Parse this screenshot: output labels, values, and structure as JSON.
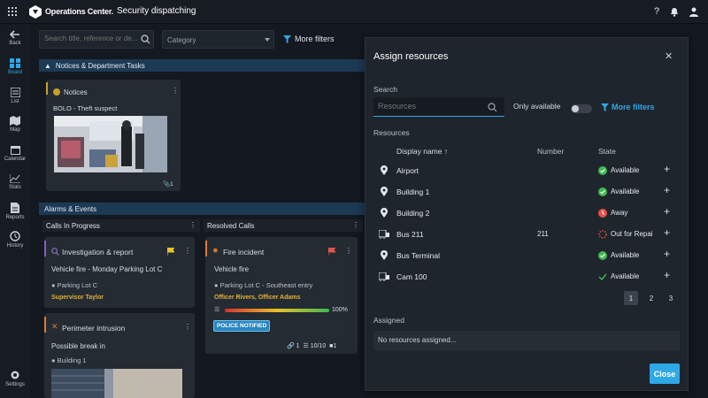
{
  "topbar": {
    "app_name": "Operations Center.",
    "page_title": "Security dispatching"
  },
  "sidebar": {
    "items": [
      {
        "label": "Back"
      },
      {
        "label": "Board"
      },
      {
        "label": "List"
      },
      {
        "label": "Map"
      },
      {
        "label": "Calendar"
      },
      {
        "label": "Stats"
      },
      {
        "label": "Reports"
      },
      {
        "label": "History"
      },
      {
        "label": "Settings"
      }
    ]
  },
  "filters": {
    "search_placeholder": "Search title, reference or de...",
    "category": "Category",
    "more_filters": "More filters"
  },
  "notices": {
    "section_title": "Notices & Department Tasks",
    "card_title": "Notices",
    "item_title": "BOLO - Theft suspect",
    "attachments": "1"
  },
  "alarms": {
    "section_title": "Alarms & Events",
    "col1": "Calls In Progress",
    "col2": "Resolved Calls",
    "c1": {
      "title": "Investigation & report",
      "subtitle": "Vehicle fire - Monday Parking Lot C",
      "location": "Parking Lot C",
      "assignee": "Supervisor Taylor"
    },
    "c2": {
      "title": "Perimeter intrusion",
      "subtitle": "Possible break in",
      "location": "Building 1"
    },
    "c3": {
      "title": "Fire incident",
      "subtitle": "Vehicle fire",
      "location": "Parking Lot C - Southeast entry",
      "assignee": "Officer Rivers, Officer Adams",
      "progress": "100%",
      "badge": "POLICE NOTIFIED",
      "links": "1",
      "tasks": "10/10",
      "comments": "1"
    }
  },
  "modal": {
    "title": "Assign resources",
    "search_label": "Search",
    "search_placeholder": "Resources",
    "only_available": "Only available",
    "more_filters": "More filters",
    "resources_label": "Resources",
    "col_name": "Display name",
    "col_number": "Number",
    "col_state": "State",
    "rows": [
      {
        "name": "Airport",
        "number": "",
        "state": "Available"
      },
      {
        "name": "Building 1",
        "number": "",
        "state": "Available"
      },
      {
        "name": "Building 2",
        "number": "",
        "state": "Away"
      },
      {
        "name": "Bus 211",
        "number": "211",
        "state": "Out for Repai"
      },
      {
        "name": "Bus Terminal",
        "number": "",
        "state": "Available"
      },
      {
        "name": "Cam 100",
        "number": "",
        "state": "Available"
      }
    ],
    "pages": [
      "1",
      "2",
      "3"
    ],
    "assigned_label": "Assigned",
    "assigned_empty": "No resources assigned...",
    "close": "Close"
  },
  "colors": {
    "accent": "#2ea8e6",
    "available": "#3fb950",
    "away": "#e5534b",
    "repair": "#e5534b"
  }
}
